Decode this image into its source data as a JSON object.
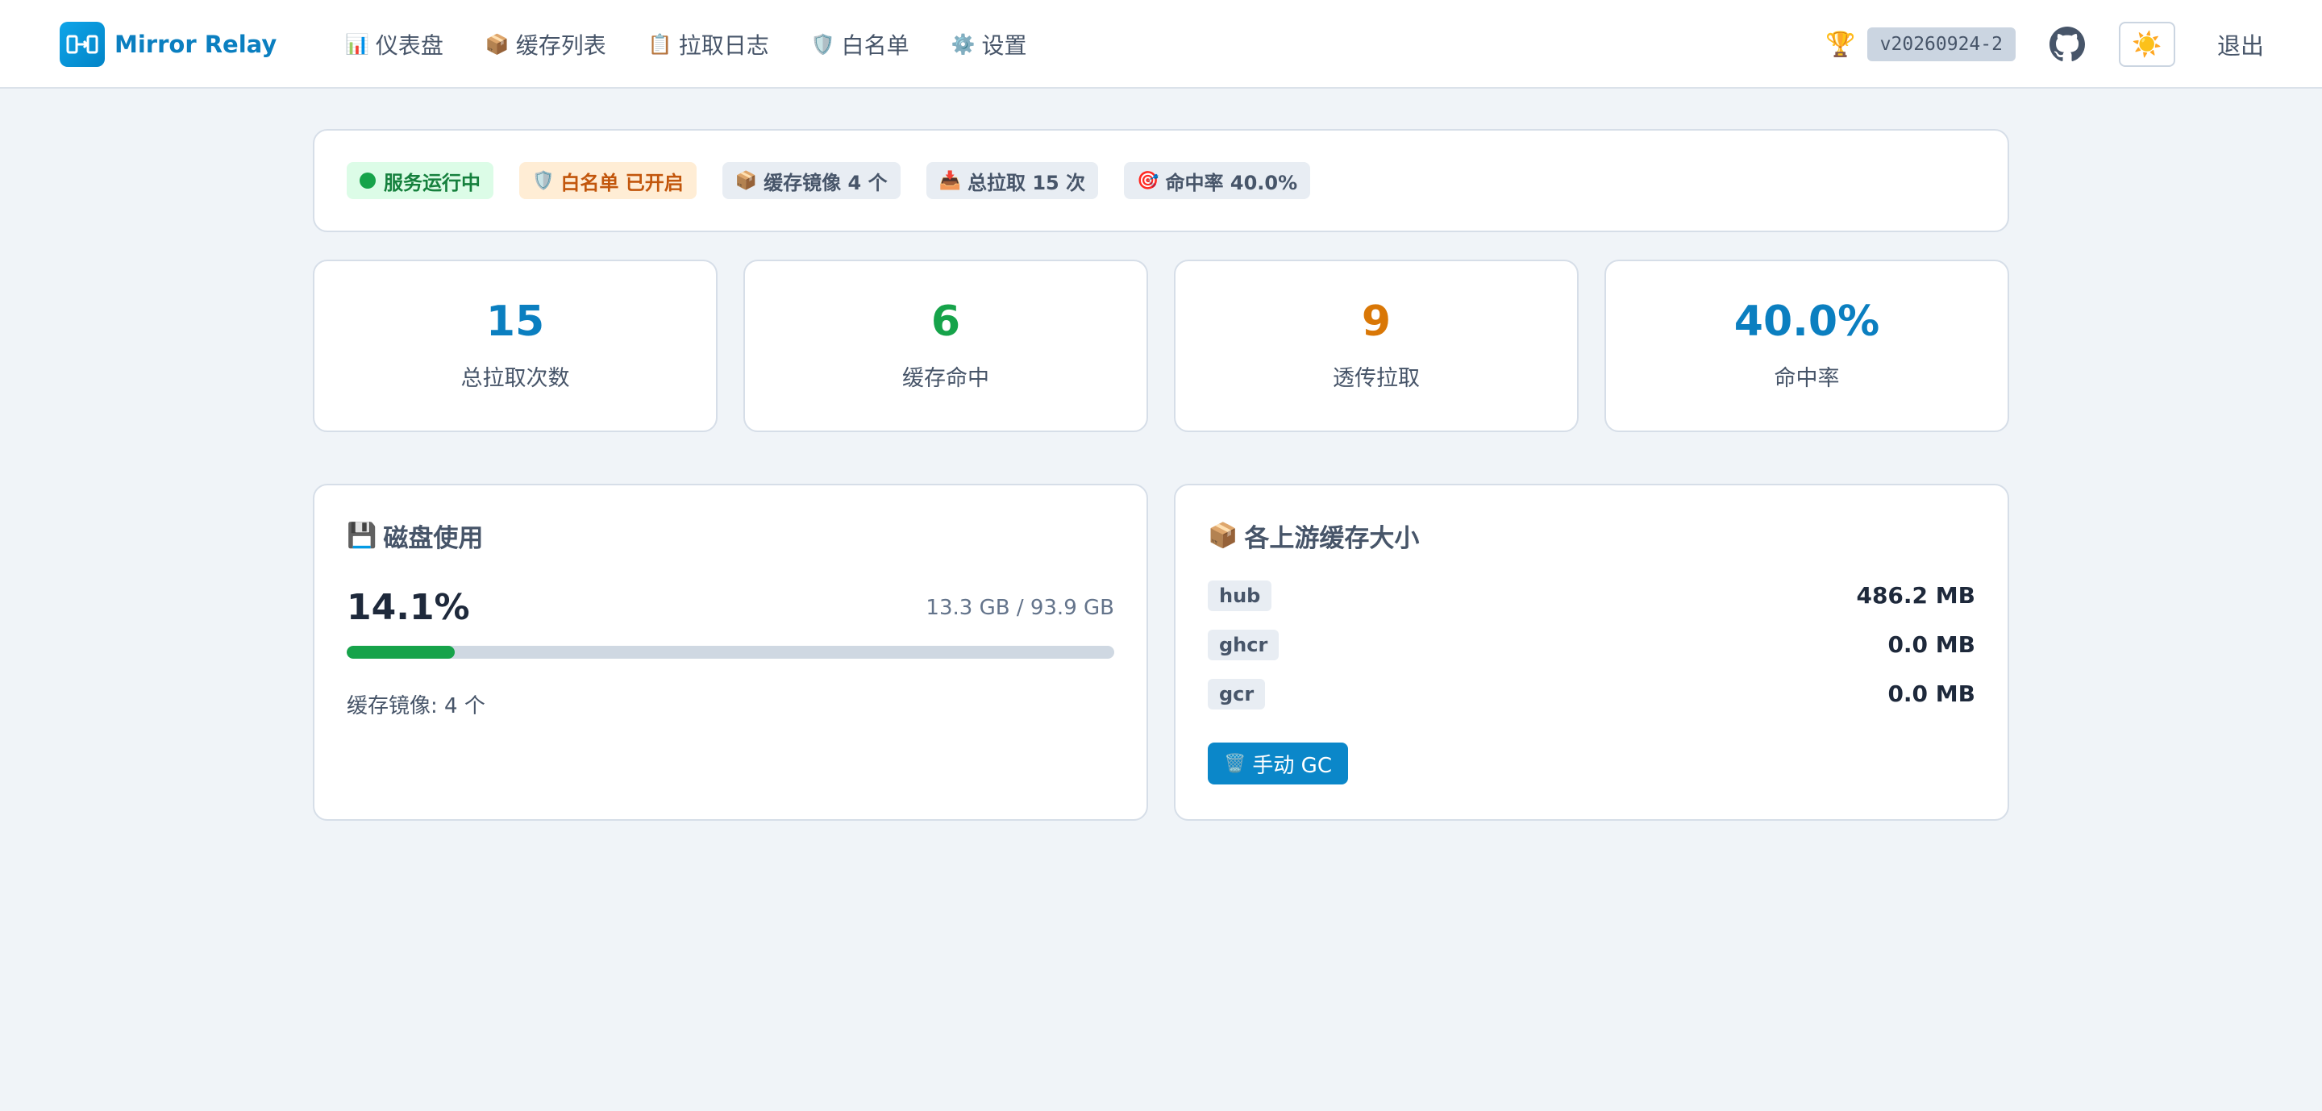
{
  "app": {
    "name": "Mirror Relay",
    "version": "v20260924-2",
    "logout_label": "退出",
    "theme_icon": "sun-icon",
    "colors": {
      "brand": "#0b7fc0",
      "accent": "#0ea5e9",
      "success": "#16a34a",
      "warning": "#d97706",
      "primary_button": "#0b87c9"
    }
  },
  "nav": [
    {
      "icon": "📊",
      "label": "仪表盘"
    },
    {
      "icon": "📦",
      "label": "缓存列表"
    },
    {
      "icon": "📋",
      "label": "拉取日志"
    },
    {
      "icon": "🛡️",
      "label": "白名单"
    },
    {
      "icon": "⚙️",
      "label": "设置"
    }
  ],
  "status": {
    "running": "服务运行中",
    "whitelist": "白名单 已开启",
    "cached_images": "缓存镜像 4 个",
    "total_pulls": "总拉取 15 次",
    "hit_rate": "命中率 40.0%"
  },
  "stats": [
    {
      "value": "15",
      "label": "总拉取次数",
      "color": "#0b7fc0"
    },
    {
      "value": "6",
      "label": "缓存命中",
      "color": "#16a34a"
    },
    {
      "value": "9",
      "label": "透传拉取",
      "color": "#d97706"
    },
    {
      "value": "40.0%",
      "label": "命中率",
      "color": "#0b7fc0"
    }
  ],
  "disk": {
    "title": "磁盘使用",
    "percent_text": "14.1%",
    "percent": 14.1,
    "size_text": "13.3 GB / 93.9 GB",
    "images_text": "缓存镜像: 4 个"
  },
  "upstreams": {
    "title": "各上游缓存大小",
    "items": [
      {
        "name": "hub",
        "size": "486.2 MB"
      },
      {
        "name": "ghcr",
        "size": "0.0 MB"
      },
      {
        "name": "gcr",
        "size": "0.0 MB"
      }
    ],
    "gc_label": "手动 GC"
  }
}
